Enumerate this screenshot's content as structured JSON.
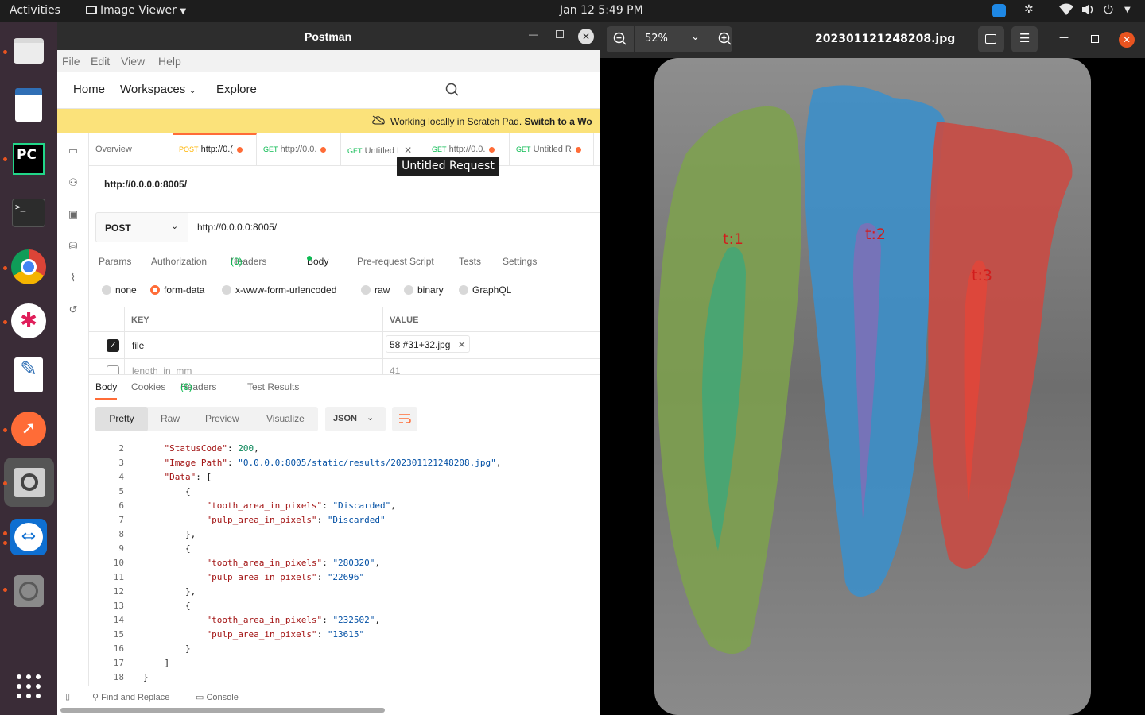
{
  "system": {
    "activities": "Activities",
    "app_menu": "Image Viewer",
    "clock": "Jan 12  5:49 PM"
  },
  "postman": {
    "window_title": "Postman",
    "menu": [
      "File",
      "Edit",
      "View",
      "Help"
    ],
    "nav": {
      "home": "Home",
      "workspaces": "Workspaces",
      "explore": "Explore"
    },
    "banner": {
      "text": "Working locally in Scratch Pad.",
      "link": "Switch to a Wo"
    },
    "tabs": [
      {
        "method": "",
        "label": "Overview"
      },
      {
        "method": "POST",
        "label": "http://0.("
      },
      {
        "method": "GET",
        "label": "http://0.0."
      },
      {
        "method": "GET",
        "label": "Untitled I"
      },
      {
        "method": "GET",
        "label": "http://0.0."
      },
      {
        "method": "GET",
        "label": "Untitled R"
      }
    ],
    "tooltip": "Untitled Request",
    "request_title": "http://0.0.0.0:8005/",
    "method": "POST",
    "url": "http://0.0.0.0:8005/",
    "request_tabs": [
      "Params",
      "Authorization",
      "Headers",
      "(8)",
      "Body",
      "Pre-request Script",
      "Tests",
      "Settings"
    ],
    "body_options": [
      "none",
      "form-data",
      "x-www-form-urlencoded",
      "raw",
      "binary",
      "GraphQL"
    ],
    "kv": {
      "key_header": "KEY",
      "value_header": "VALUE",
      "row1_key": "file",
      "row1_value": "58 #31+32.jpg",
      "row2_key": "length_in_mm",
      "row2_value": "41"
    },
    "response_tabs": [
      "Body",
      "Cookies",
      "Headers",
      "(9)",
      "Test Results"
    ],
    "view_modes": [
      "Pretty",
      "Raw",
      "Preview",
      "Visualize"
    ],
    "format": "JSON",
    "code_lines": [
      {
        "n": "2",
        "indent": "    ",
        "key": "\"StatusCode\"",
        "sep": ": ",
        "val": "200",
        "vtype": "n",
        "tail": ","
      },
      {
        "n": "3",
        "indent": "    ",
        "key": "\"Image Path\"",
        "sep": ": ",
        "val": "\"0.0.0.0:8005/static/results/202301121248208.jpg\"",
        "vtype": "s",
        "tail": ","
      },
      {
        "n": "4",
        "indent": "    ",
        "key": "\"Data\"",
        "sep": ": ",
        "val": "",
        "vtype": "",
        "tail": "["
      },
      {
        "n": "5",
        "indent": "        ",
        "key": "",
        "sep": "",
        "val": "",
        "vtype": "",
        "tail": "{"
      },
      {
        "n": "6",
        "indent": "            ",
        "key": "\"tooth_area_in_pixels\"",
        "sep": ": ",
        "val": "\"Discarded\"",
        "vtype": "s",
        "tail": ","
      },
      {
        "n": "7",
        "indent": "            ",
        "key": "\"pulp_area_in_pixels\"",
        "sep": ": ",
        "val": "\"Discarded\"",
        "vtype": "s",
        "tail": ""
      },
      {
        "n": "8",
        "indent": "        ",
        "key": "",
        "sep": "",
        "val": "",
        "vtype": "",
        "tail": "},"
      },
      {
        "n": "9",
        "indent": "        ",
        "key": "",
        "sep": "",
        "val": "",
        "vtype": "",
        "tail": "{"
      },
      {
        "n": "10",
        "indent": "            ",
        "key": "\"tooth_area_in_pixels\"",
        "sep": ": ",
        "val": "\"280320\"",
        "vtype": "s",
        "tail": ","
      },
      {
        "n": "11",
        "indent": "            ",
        "key": "\"pulp_area_in_pixels\"",
        "sep": ": ",
        "val": "\"22696\"",
        "vtype": "s",
        "tail": ""
      },
      {
        "n": "12",
        "indent": "        ",
        "key": "",
        "sep": "",
        "val": "",
        "vtype": "",
        "tail": "},"
      },
      {
        "n": "13",
        "indent": "        ",
        "key": "",
        "sep": "",
        "val": "",
        "vtype": "",
        "tail": "{"
      },
      {
        "n": "14",
        "indent": "            ",
        "key": "\"tooth_area_in_pixels\"",
        "sep": ": ",
        "val": "\"232502\"",
        "vtype": "s",
        "tail": ","
      },
      {
        "n": "15",
        "indent": "            ",
        "key": "\"pulp_area_in_pixels\"",
        "sep": ": ",
        "val": "\"13615\"",
        "vtype": "s",
        "tail": ""
      },
      {
        "n": "16",
        "indent": "        ",
        "key": "",
        "sep": "",
        "val": "",
        "vtype": "",
        "tail": "}"
      },
      {
        "n": "17",
        "indent": "    ",
        "key": "",
        "sep": "",
        "val": "",
        "vtype": "",
        "tail": "]"
      },
      {
        "n": "18",
        "indent": "",
        "key": "",
        "sep": "",
        "val": "",
        "vtype": "",
        "tail": "}"
      }
    ],
    "status_bar": {
      "find": "Find and Replace",
      "console": "Console"
    }
  },
  "viewer": {
    "zoom": "52%",
    "filename": "202301121248208.jpg",
    "labels": [
      "t:1",
      "t:2",
      "t:3"
    ]
  },
  "colors": {
    "accent": "#ff6c37",
    "banner": "#fbe27a",
    "dock": "#3a2c37"
  }
}
